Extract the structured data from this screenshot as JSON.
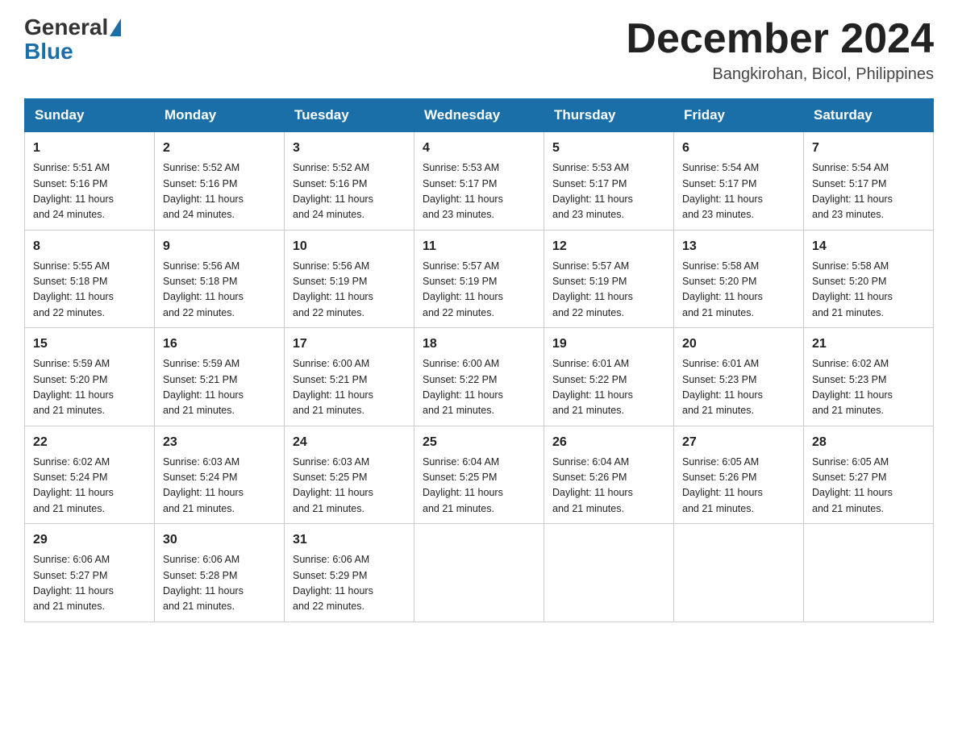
{
  "header": {
    "logo_general": "General",
    "logo_blue": "Blue",
    "month_title": "December 2024",
    "location": "Bangkirohan, Bicol, Philippines"
  },
  "days_of_week": [
    "Sunday",
    "Monday",
    "Tuesday",
    "Wednesday",
    "Thursday",
    "Friday",
    "Saturday"
  ],
  "weeks": [
    [
      {
        "day": "1",
        "sunrise": "5:51 AM",
        "sunset": "5:16 PM",
        "daylight": "11 hours and 24 minutes."
      },
      {
        "day": "2",
        "sunrise": "5:52 AM",
        "sunset": "5:16 PM",
        "daylight": "11 hours and 24 minutes."
      },
      {
        "day": "3",
        "sunrise": "5:52 AM",
        "sunset": "5:16 PM",
        "daylight": "11 hours and 24 minutes."
      },
      {
        "day": "4",
        "sunrise": "5:53 AM",
        "sunset": "5:17 PM",
        "daylight": "11 hours and 23 minutes."
      },
      {
        "day": "5",
        "sunrise": "5:53 AM",
        "sunset": "5:17 PM",
        "daylight": "11 hours and 23 minutes."
      },
      {
        "day": "6",
        "sunrise": "5:54 AM",
        "sunset": "5:17 PM",
        "daylight": "11 hours and 23 minutes."
      },
      {
        "day": "7",
        "sunrise": "5:54 AM",
        "sunset": "5:17 PM",
        "daylight": "11 hours and 23 minutes."
      }
    ],
    [
      {
        "day": "8",
        "sunrise": "5:55 AM",
        "sunset": "5:18 PM",
        "daylight": "11 hours and 22 minutes."
      },
      {
        "day": "9",
        "sunrise": "5:56 AM",
        "sunset": "5:18 PM",
        "daylight": "11 hours and 22 minutes."
      },
      {
        "day": "10",
        "sunrise": "5:56 AM",
        "sunset": "5:19 PM",
        "daylight": "11 hours and 22 minutes."
      },
      {
        "day": "11",
        "sunrise": "5:57 AM",
        "sunset": "5:19 PM",
        "daylight": "11 hours and 22 minutes."
      },
      {
        "day": "12",
        "sunrise": "5:57 AM",
        "sunset": "5:19 PM",
        "daylight": "11 hours and 22 minutes."
      },
      {
        "day": "13",
        "sunrise": "5:58 AM",
        "sunset": "5:20 PM",
        "daylight": "11 hours and 21 minutes."
      },
      {
        "day": "14",
        "sunrise": "5:58 AM",
        "sunset": "5:20 PM",
        "daylight": "11 hours and 21 minutes."
      }
    ],
    [
      {
        "day": "15",
        "sunrise": "5:59 AM",
        "sunset": "5:20 PM",
        "daylight": "11 hours and 21 minutes."
      },
      {
        "day": "16",
        "sunrise": "5:59 AM",
        "sunset": "5:21 PM",
        "daylight": "11 hours and 21 minutes."
      },
      {
        "day": "17",
        "sunrise": "6:00 AM",
        "sunset": "5:21 PM",
        "daylight": "11 hours and 21 minutes."
      },
      {
        "day": "18",
        "sunrise": "6:00 AM",
        "sunset": "5:22 PM",
        "daylight": "11 hours and 21 minutes."
      },
      {
        "day": "19",
        "sunrise": "6:01 AM",
        "sunset": "5:22 PM",
        "daylight": "11 hours and 21 minutes."
      },
      {
        "day": "20",
        "sunrise": "6:01 AM",
        "sunset": "5:23 PM",
        "daylight": "11 hours and 21 minutes."
      },
      {
        "day": "21",
        "sunrise": "6:02 AM",
        "sunset": "5:23 PM",
        "daylight": "11 hours and 21 minutes."
      }
    ],
    [
      {
        "day": "22",
        "sunrise": "6:02 AM",
        "sunset": "5:24 PM",
        "daylight": "11 hours and 21 minutes."
      },
      {
        "day": "23",
        "sunrise": "6:03 AM",
        "sunset": "5:24 PM",
        "daylight": "11 hours and 21 minutes."
      },
      {
        "day": "24",
        "sunrise": "6:03 AM",
        "sunset": "5:25 PM",
        "daylight": "11 hours and 21 minutes."
      },
      {
        "day": "25",
        "sunrise": "6:04 AM",
        "sunset": "5:25 PM",
        "daylight": "11 hours and 21 minutes."
      },
      {
        "day": "26",
        "sunrise": "6:04 AM",
        "sunset": "5:26 PM",
        "daylight": "11 hours and 21 minutes."
      },
      {
        "day": "27",
        "sunrise": "6:05 AM",
        "sunset": "5:26 PM",
        "daylight": "11 hours and 21 minutes."
      },
      {
        "day": "28",
        "sunrise": "6:05 AM",
        "sunset": "5:27 PM",
        "daylight": "11 hours and 21 minutes."
      }
    ],
    [
      {
        "day": "29",
        "sunrise": "6:06 AM",
        "sunset": "5:27 PM",
        "daylight": "11 hours and 21 minutes."
      },
      {
        "day": "30",
        "sunrise": "6:06 AM",
        "sunset": "5:28 PM",
        "daylight": "11 hours and 21 minutes."
      },
      {
        "day": "31",
        "sunrise": "6:06 AM",
        "sunset": "5:29 PM",
        "daylight": "11 hours and 22 minutes."
      },
      null,
      null,
      null,
      null
    ]
  ],
  "labels": {
    "sunrise": "Sunrise:",
    "sunset": "Sunset:",
    "daylight": "Daylight:"
  }
}
